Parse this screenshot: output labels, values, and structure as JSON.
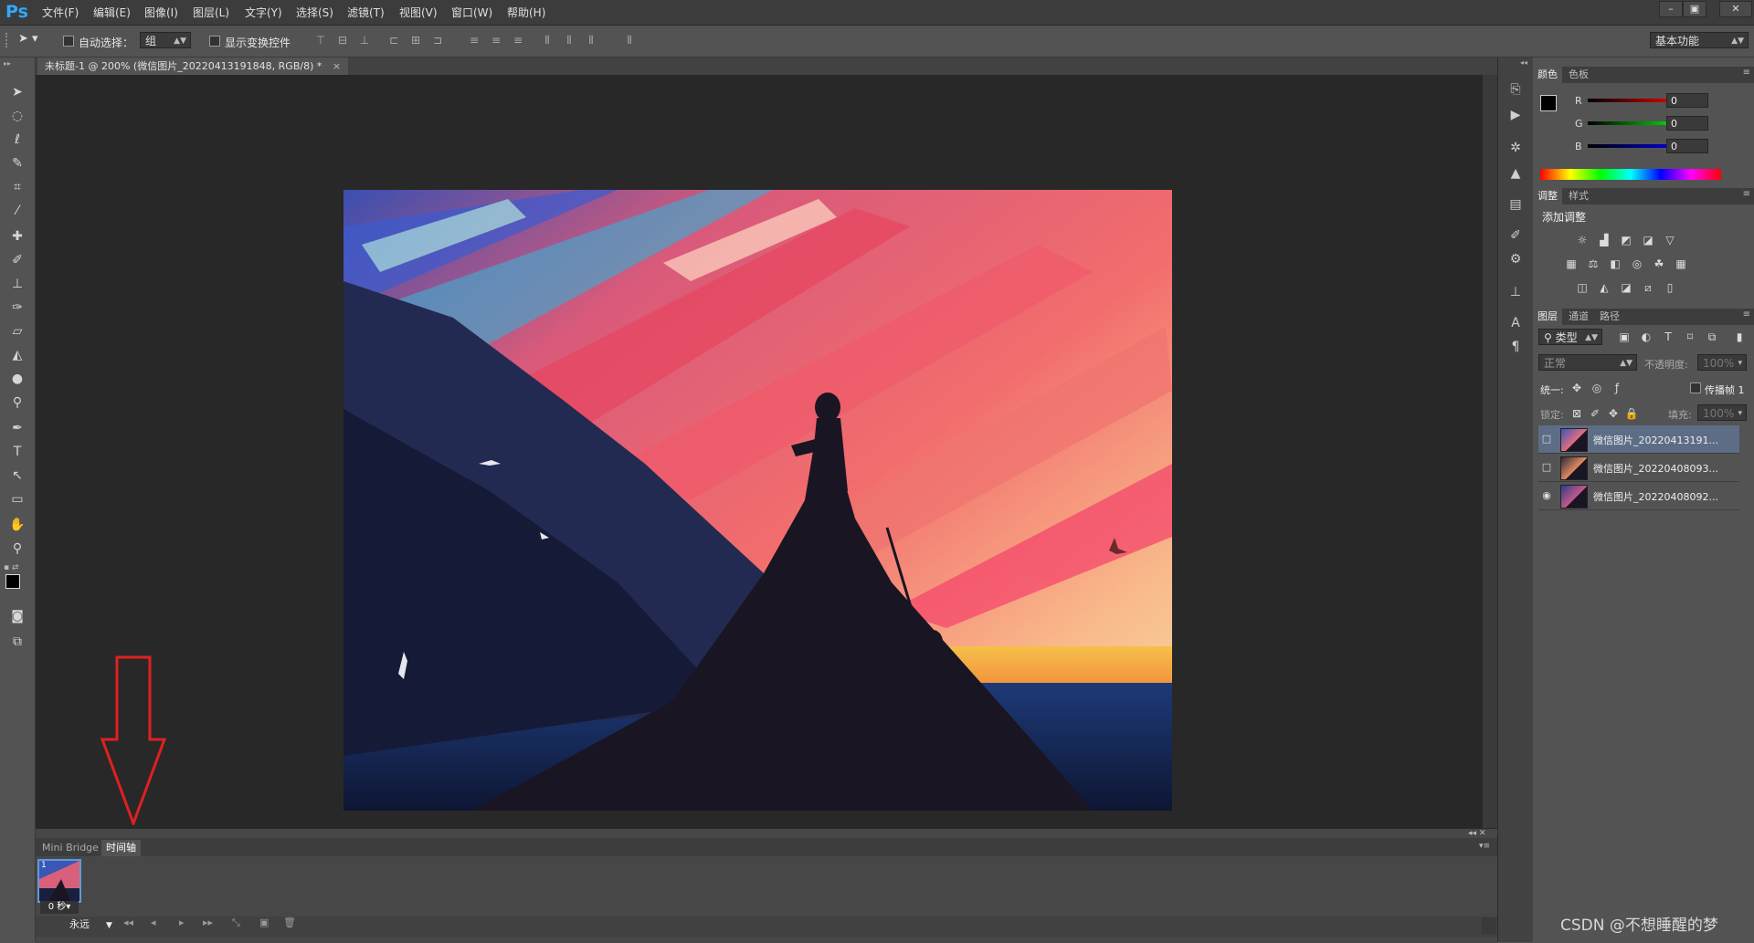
{
  "app": {
    "logo": "Ps"
  },
  "menubar": {
    "items": [
      "文件(F)",
      "编辑(E)",
      "图像(I)",
      "图层(L)",
      "文字(Y)",
      "选择(S)",
      "滤镜(T)",
      "视图(V)",
      "窗口(W)",
      "帮助(H)"
    ]
  },
  "window_controls": {
    "minimize": "–",
    "restore": "▣",
    "close": "✕"
  },
  "options": {
    "auto_select_label": "自动选择：",
    "auto_select_value": "组",
    "show_transform_label": "显示变换控件",
    "workspace": "基本功能"
  },
  "document": {
    "tab_title": "未标题-1 @ 200% (微信图片_20220413191848, RGB/8) *",
    "tab_close": "×"
  },
  "timeline": {
    "tabs": [
      "Mini Bridge",
      "时间轴"
    ],
    "active_tab": 1,
    "frame_number": "1",
    "frame_duration": "0 秒▾",
    "loop": "永远"
  },
  "color_panel": {
    "tabs": [
      "颜色",
      "色板"
    ],
    "channels": [
      {
        "label": "R",
        "value": "0"
      },
      {
        "label": "G",
        "value": "0"
      },
      {
        "label": "B",
        "value": "0"
      }
    ]
  },
  "adjust_panel": {
    "tabs": [
      "调整",
      "样式"
    ],
    "add_label": "添加调整"
  },
  "layers_panel": {
    "tabs": [
      "图层",
      "通道",
      "路径"
    ],
    "filter": "类型",
    "blend_mode": "正常",
    "opacity_label": "不透明度:",
    "opacity_value": "100%",
    "unify_label": "统一:",
    "propagate_label": "传播帧 1",
    "lock_label": "锁定:",
    "fill_label": "填充:",
    "fill_value": "100%",
    "layers": [
      {
        "name": "微信图片_20220413191...",
        "selected": true,
        "visible": false
      },
      {
        "name": "微信图片_20220408093...",
        "selected": false,
        "visible": false
      },
      {
        "name": "微信图片_20220408092...",
        "selected": false,
        "visible": true
      }
    ]
  },
  "watermark": "CSDN @不想睡醒的梦",
  "accent_color": "#e02020"
}
